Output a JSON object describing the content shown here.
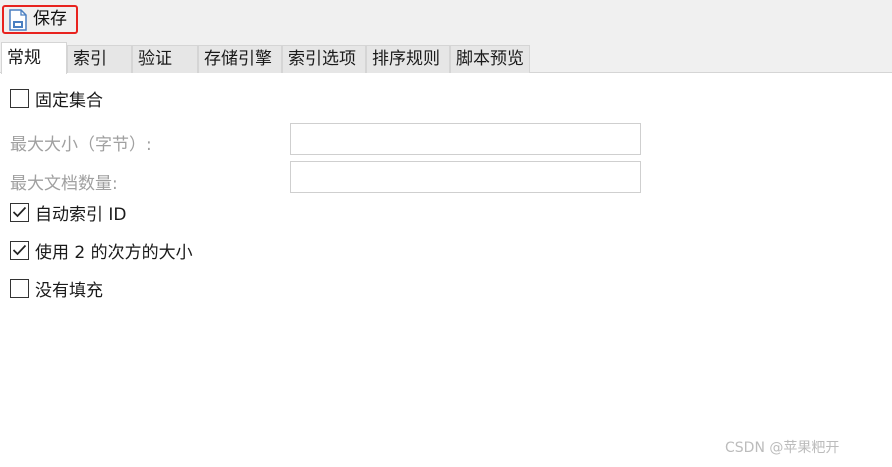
{
  "toolbar": {
    "save_label": "保存",
    "save_icon": "save-file-icon"
  },
  "tabs": [
    {
      "label": "常规",
      "active": true
    },
    {
      "label": "索引",
      "active": false
    },
    {
      "label": "验证",
      "active": false
    },
    {
      "label": "存储引擎",
      "active": false
    },
    {
      "label": "索引选项",
      "active": false
    },
    {
      "label": "排序规则",
      "active": false
    },
    {
      "label": "脚本预览",
      "active": false
    }
  ],
  "general": {
    "capped": {
      "label": "固定集合",
      "checked": false
    },
    "max_size": {
      "label": "最大大小（字节）:",
      "value": ""
    },
    "max_docs": {
      "label": "最大文档数量:",
      "value": ""
    },
    "auto_index_id": {
      "label": "自动索引 ID",
      "checked": true
    },
    "power_of_2": {
      "label": "使用 2 的次方的大小",
      "checked": true
    },
    "no_padding": {
      "label": "没有填充",
      "checked": false
    }
  },
  "watermark": "CSDN @苹果粑开",
  "colors": {
    "highlight": "#e8231f",
    "icon_blue": "#4a7fc1"
  }
}
